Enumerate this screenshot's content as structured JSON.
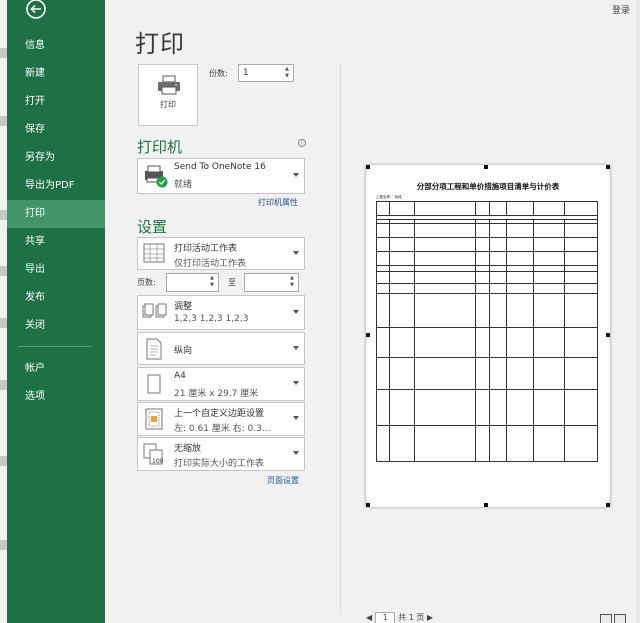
{
  "account": "登录",
  "title": "打印",
  "nav": {
    "items": [
      {
        "label": "信息"
      },
      {
        "label": "新建"
      },
      {
        "label": "打开"
      },
      {
        "label": "保存"
      },
      {
        "label": "另存为"
      },
      {
        "label": "导出为PDF"
      },
      {
        "label": "打印"
      },
      {
        "label": "共享"
      },
      {
        "label": "导出"
      },
      {
        "label": "发布"
      },
      {
        "label": "关闭"
      },
      {
        "label": "帐户"
      },
      {
        "label": "选项"
      }
    ]
  },
  "print_button": {
    "label": "打印"
  },
  "copies": {
    "label": "份数:",
    "value": "1"
  },
  "printer": {
    "heading": "打印机",
    "name": "Send To OneNote 16",
    "status": "就绪",
    "properties_link": "打印机属性"
  },
  "settings": {
    "heading": "设置",
    "scope": {
      "title": "打印活动工作表",
      "desc": "仅打印活动工作表"
    },
    "pages": {
      "label": "页数:",
      "to": "至",
      "from_value": "",
      "to_value": ""
    },
    "collate": {
      "title": "调整",
      "desc": "1,2,3    1,2,3    1,2,3"
    },
    "orientation": {
      "title": "纵向"
    },
    "paper": {
      "title": "A4",
      "desc": "21 厘米 x 29.7 厘米"
    },
    "margins": {
      "title": "上一个自定义边距设置",
      "desc": "左: 0.61 厘米    右: 0.3..."
    },
    "scaling": {
      "title": "无缩放",
      "desc": "打印实际大小的工作表"
    },
    "page_setup_link": "页面设置"
  },
  "preview": {
    "doc_title": "分部分项工程和单价措施项目清单与计价表",
    "doc_sub": "工程名称：      标段",
    "page_of": "共 1 页",
    "page_num": "1"
  }
}
